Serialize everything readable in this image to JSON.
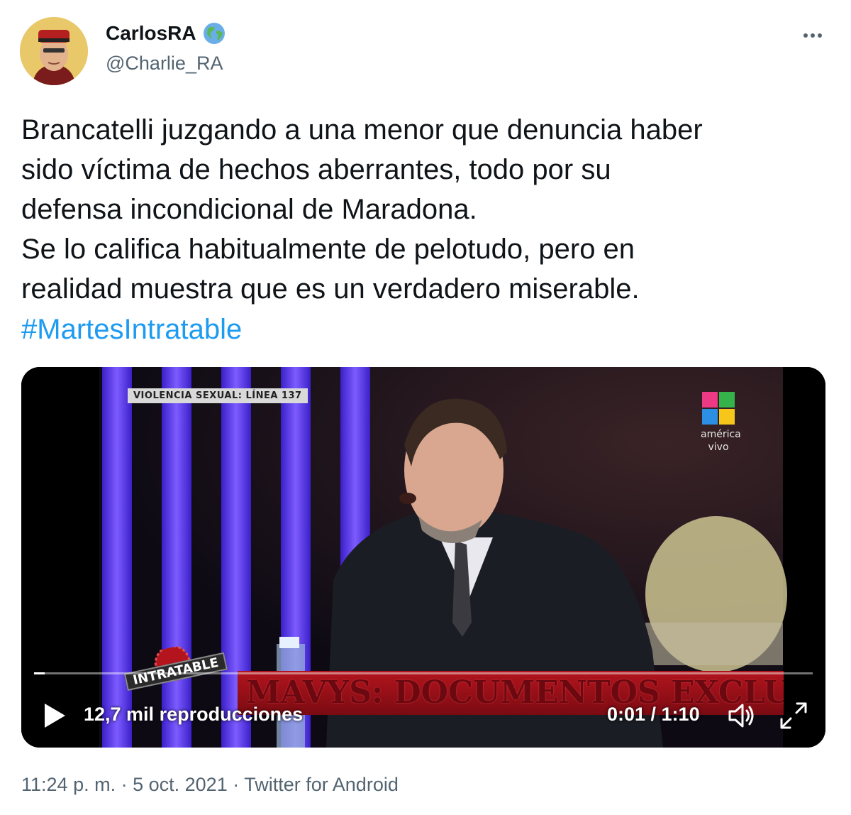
{
  "author": {
    "name": "CarlosRA",
    "badge_icon": "globe-emoji-icon",
    "handle": "@Charlie_RA",
    "avatar_icon": "avatar-icon"
  },
  "tweet": {
    "text": "Brancatelli juzgando a una menor que denuncia haber\nsido víctima de hechos aberrantes, todo por su\ndefensa incondicional de Maradona.\nSe lo califica habitualmente de pelotudo, pero en\nrealidad muestra que es un verdadero miserable.",
    "hashtag": "#MartesIntratable",
    "hashtag_color": "#1d9bf0"
  },
  "video": {
    "lower_third": "VIOLENCIA SEXUAL: LÍNEA 137",
    "channel_name_line1": "américa",
    "channel_name_line2": "vivo",
    "show_logo": "INTRATABLE",
    "banner_text": "MAVYS: DOCUMENTOS EXCLUSIVOS",
    "views": "12,7 mil reproducciones",
    "time": "0:01 / 1:10",
    "progress": 0.014
  },
  "footer": {
    "time": "11:24 p. m.",
    "separator": "·",
    "date": "5 oct. 2021",
    "source": "Twitter for Android"
  },
  "colors": {
    "text": "#0f1419",
    "secondary": "#536471",
    "link": "#1d9bf0",
    "banner_red": "#b3141d"
  }
}
